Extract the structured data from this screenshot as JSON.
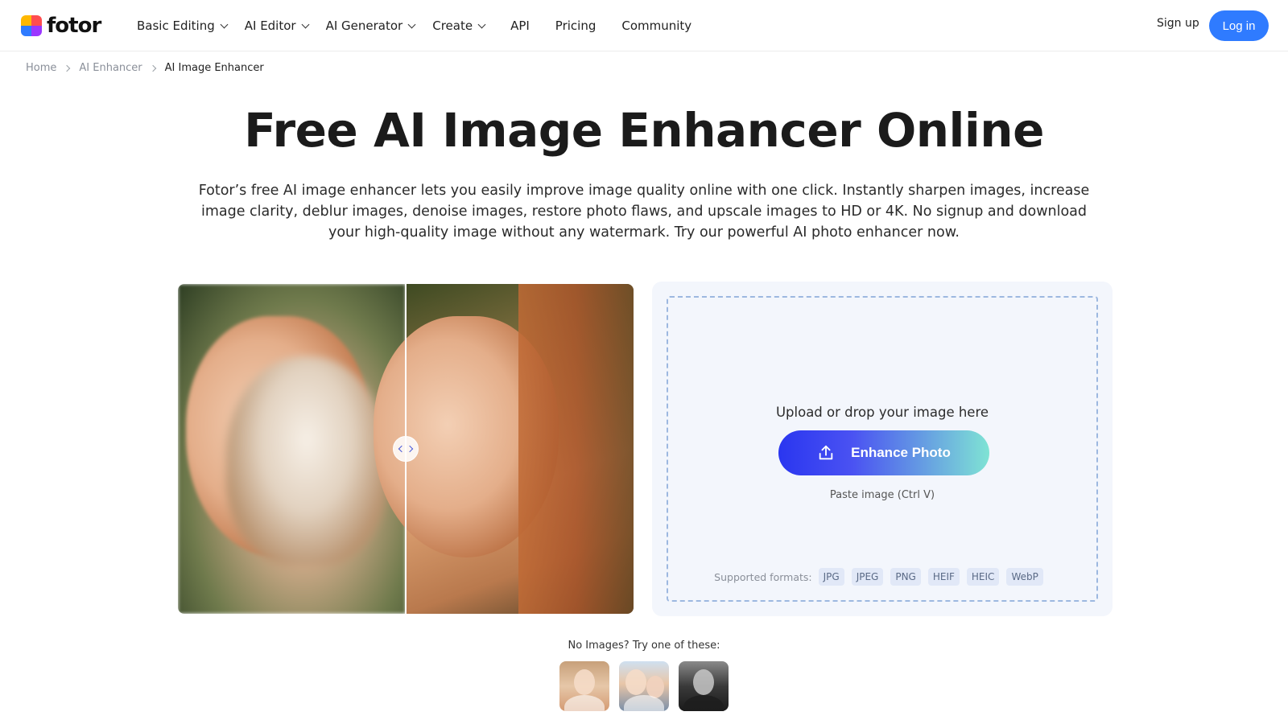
{
  "header": {
    "logo_text": "fotor",
    "nav": [
      {
        "label": "Basic Editing",
        "dropdown": true
      },
      {
        "label": "AI Editor",
        "dropdown": true
      },
      {
        "label": "AI Generator",
        "dropdown": true
      },
      {
        "label": "Create",
        "dropdown": true
      },
      {
        "label": "API",
        "dropdown": false
      },
      {
        "label": "Pricing",
        "dropdown": false
      },
      {
        "label": "Community",
        "dropdown": false
      }
    ],
    "signup_label": "Sign up",
    "login_label": "Log in",
    "accent_color": "#2f7bff"
  },
  "breadcrumb": {
    "items": [
      "Home",
      "AI Enhancer",
      "AI Image Enhancer"
    ]
  },
  "hero": {
    "title": "Free AI Image Enhancer Online",
    "subtitle": "Fotor’s free AI image enhancer lets you easily improve image quality online with one click. Instantly sharpen images, increase image clarity, deblur images, denoise images, restore photo flaws, and upscale images to HD or 4K. No signup and download your high-quality image without any watermark. Try our powerful AI photo enhancer now."
  },
  "compare": {
    "handle_icon": "compare-slider-arrows-icon"
  },
  "upload": {
    "drop_text": "Upload or drop your image here",
    "button_label": "Enhance Photo",
    "button_icon": "upload-icon",
    "paste_hint": "Paste image (Ctrl V)",
    "formats_label": "Supported formats:",
    "formats": [
      "JPG",
      "JPEG",
      "PNG",
      "HEIF",
      "HEIC",
      "WebP"
    ]
  },
  "samples": {
    "label": "No Images? Try one of these:"
  }
}
